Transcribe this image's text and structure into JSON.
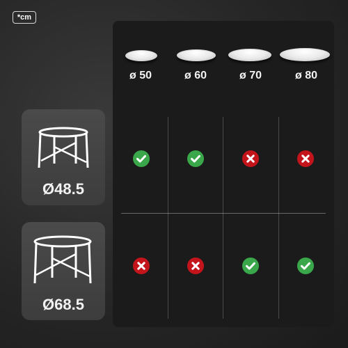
{
  "unit_note": "*cm",
  "plate_sizes": [
    "ø 50",
    "ø 60",
    "ø 70",
    "ø 80"
  ],
  "tables": [
    {
      "label": "Ø48.5",
      "fits": [
        true,
        true,
        false,
        false
      ]
    },
    {
      "label": "Ø68.5",
      "fits": [
        false,
        false,
        true,
        true
      ]
    }
  ],
  "colors": {
    "check": "#3aa84a",
    "cross": "#c3141c"
  },
  "icons": {
    "fit": "check-circle-icon",
    "no_fit": "x-circle-icon"
  }
}
